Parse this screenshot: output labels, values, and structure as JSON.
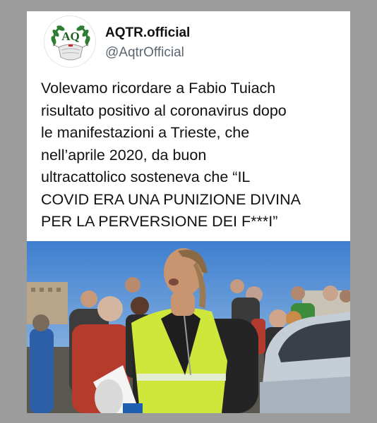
{
  "tweet": {
    "avatar": {
      "icon": "aqtr-logo-icon",
      "logo_text": "AQ"
    },
    "display_name": "AQTR.official",
    "handle": "@AqtrOfficial",
    "text_lines": [
      "Volevamo ricordare a Fabio Tuiach",
      "risultato positivo al coronavirus dopo",
      "le manifestazioni a Trieste, che",
      "nell’aprile 2020, da buon",
      "ultracattolico sosteneva che “IL",
      "COVID ERA UNA PUNIZIONE DIVINA",
      "PER LA PERVERSIONE DEI F***I”"
    ],
    "media": {
      "icon": "photo-icon"
    }
  },
  "colors": {
    "background": "#9c9c9c",
    "card": "#ffffff",
    "text": "#111111",
    "handle": "#5b6670",
    "logo_green": "#2e7d32",
    "vest": "#cfe63a"
  }
}
